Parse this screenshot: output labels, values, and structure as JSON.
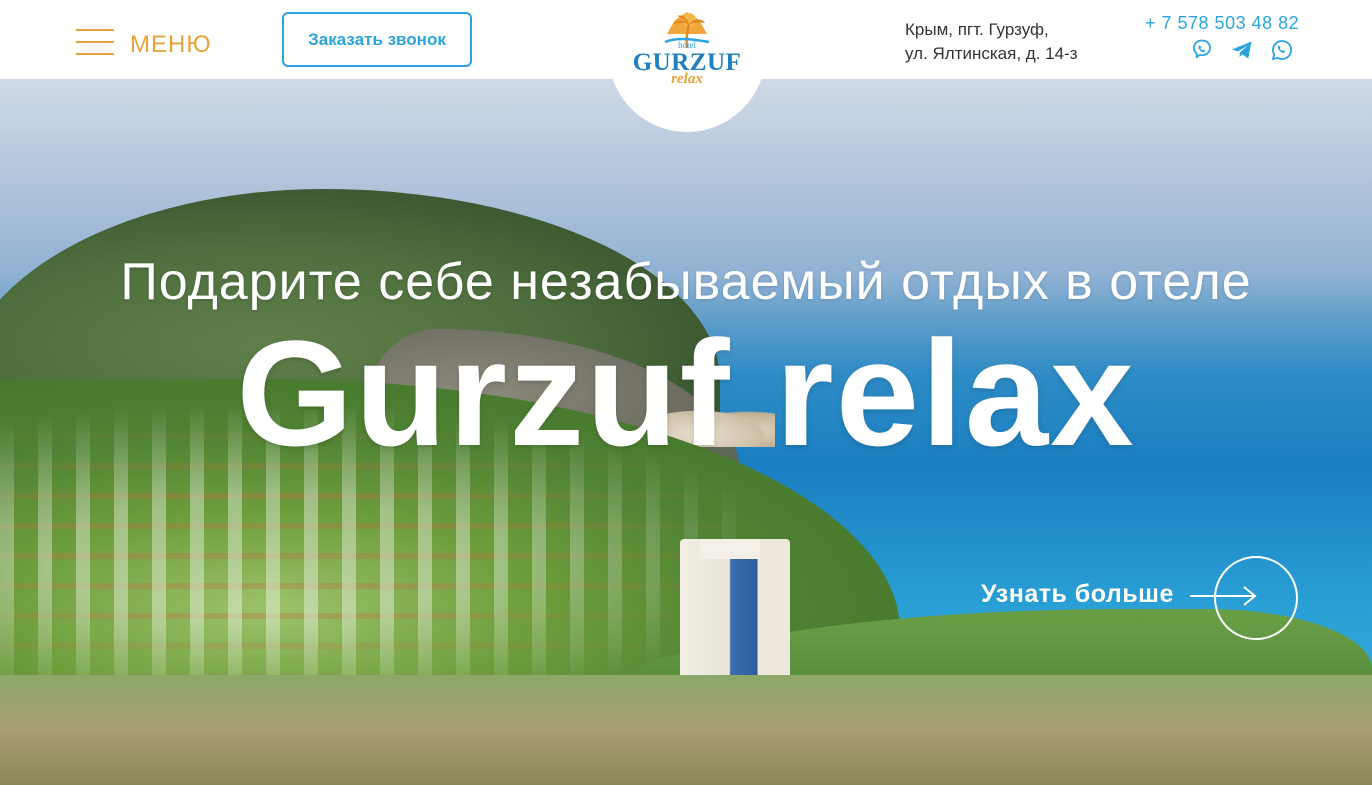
{
  "header": {
    "menu_label": "МЕНЮ",
    "call_button": "Заказать звонок",
    "address_line1": "Крым, пгт. Гурзуф,",
    "address_line2": "ул. Ялтинская, д. 14-з",
    "phone": "+ 7 578 503 48 82",
    "messengers": [
      "viber-icon",
      "telegram-icon",
      "whatsapp-icon"
    ]
  },
  "logo": {
    "hotel": "hotel",
    "name": "GURZUF",
    "relax": "relax"
  },
  "hero": {
    "subtitle": "Подарите себе незабываемый отдых в отеле",
    "title": "Gurzuf relax",
    "cta": "Узнать больше"
  },
  "colors": {
    "accent_blue": "#2aa4de",
    "accent_orange": "#e8a23a",
    "logo_blue": "#1f7fc1"
  }
}
